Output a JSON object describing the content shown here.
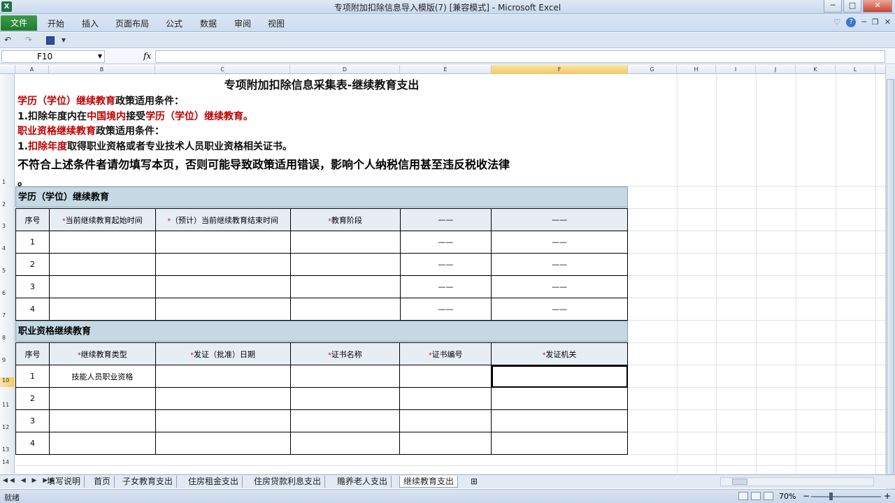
{
  "window": {
    "title": "专项附加扣除信息导入模版(7)  [兼容模式]  -  Microsoft Excel",
    "app_icon_label": "X",
    "minimize": "─",
    "maximize": "□",
    "close": "✕"
  },
  "ribbon": {
    "file_tab": "文件",
    "tabs": [
      "开始",
      "插入",
      "页面布局",
      "公式",
      "数据",
      "审阅",
      "视图"
    ],
    "help": "?"
  },
  "qat": {
    "undo": "↶",
    "redo": "↷",
    "customize": "▾"
  },
  "formula_bar": {
    "name_box": "F10",
    "fx": "fx",
    "content": ""
  },
  "columns": [
    "A",
    "B",
    "C",
    "D",
    "E",
    "F",
    "G",
    "H",
    "I",
    "J",
    "K",
    "L"
  ],
  "rows": [
    "1",
    "2",
    "3",
    "4",
    "5",
    "6",
    "7",
    "8",
    "9",
    "10",
    "11",
    "12",
    "13",
    "14"
  ],
  "sheet": {
    "title": "专项附加扣除信息采集表-继续教育支出",
    "cond1_a": "学历（学位）继续教育",
    "cond1_b": "政策适用条件：",
    "line2_a": "1.扣除年度内在",
    "line2_b": "中国境内",
    "line2_c": "接受",
    "line2_d": "学历（学位）继续教育。",
    "cond2_a": "职业资格继续教育",
    "cond2_b": "政策适用条件：",
    "line4_a": "1.",
    "line4_b": "扣除年度",
    "line4_c": "取得职业资格或者专业技术人员职业资格相关证书。",
    "warning": "不符合上述条件者请勿填写本页，否则可能导致政策适用错误，影响个人纳税信用甚至违反税收法律",
    "warning_tail": "。",
    "section1": "学历（学位）继续教育",
    "section2": "职业资格继续教育",
    "table1": {
      "headers": [
        "序号",
        "当前继续教育起始时间",
        "（预计）当前继续教育结束时间",
        "教育阶段",
        "——",
        "——"
      ],
      "rows": [
        [
          "1",
          "",
          "",
          "",
          "——",
          "——"
        ],
        [
          "2",
          "",
          "",
          "",
          "——",
          "——"
        ],
        [
          "3",
          "",
          "",
          "",
          "——",
          "——"
        ],
        [
          "4",
          "",
          "",
          "",
          "——",
          "——"
        ]
      ]
    },
    "table2": {
      "headers": [
        "序号",
        "继续教育类型",
        "发证（批准）日期",
        "证书名称",
        "证书编号",
        "发证机关"
      ],
      "rows": [
        [
          "1",
          "技能人员职业资格",
          "",
          "",
          "",
          ""
        ],
        [
          "2",
          "",
          "",
          "",
          "",
          ""
        ],
        [
          "3",
          "",
          "",
          "",
          "",
          ""
        ],
        [
          "4",
          "",
          "",
          "",
          "",
          ""
        ]
      ]
    },
    "star": "*"
  },
  "sheet_tabs": {
    "nav": "◀◀ ◀ ▶ ▶▶",
    "tabs": [
      "填写说明",
      "首页",
      "子女教育支出",
      "住房租金支出",
      "住房贷款利息支出",
      "赡养老人支出",
      "继续教育支出"
    ],
    "active_index": 6
  },
  "status": {
    "ready": "就绪",
    "zoom": "70%",
    "minus": "−",
    "plus": "+"
  }
}
